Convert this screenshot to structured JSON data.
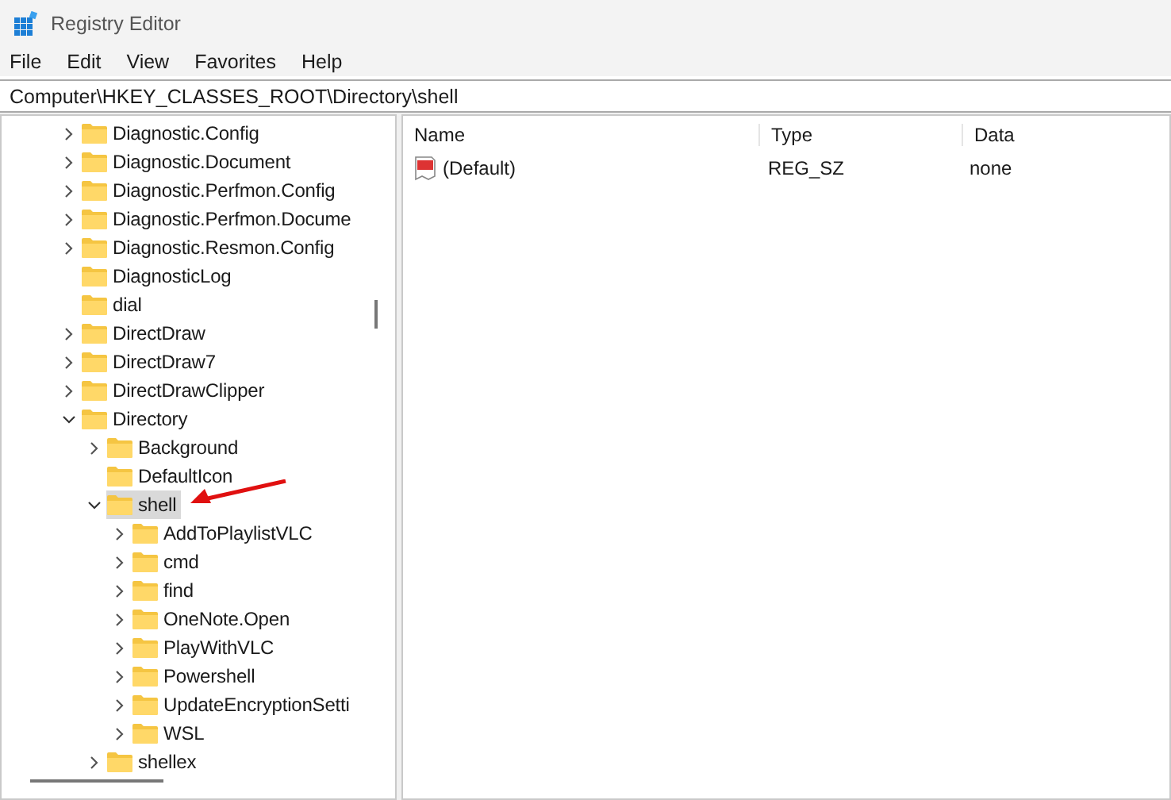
{
  "window": {
    "title": "Registry Editor"
  },
  "menu": [
    "File",
    "Edit",
    "View",
    "Favorites",
    "Help"
  ],
  "address": "Computer\\HKEY_CLASSES_ROOT\\Directory\\shell",
  "tree": [
    {
      "label": "Diagnostic.Config",
      "expandable": true,
      "expanded": false,
      "selected": false
    },
    {
      "label": "Diagnostic.Document",
      "expandable": true,
      "expanded": false,
      "selected": false
    },
    {
      "label": "Diagnostic.Perfmon.Config",
      "expandable": true,
      "expanded": false,
      "selected": false
    },
    {
      "label": "Diagnostic.Perfmon.Docume",
      "expandable": true,
      "expanded": false,
      "selected": false
    },
    {
      "label": "Diagnostic.Resmon.Config",
      "expandable": true,
      "expanded": false,
      "selected": false
    },
    {
      "label": "DiagnosticLog",
      "expandable": false,
      "expanded": false,
      "selected": false
    },
    {
      "label": "dial",
      "expandable": false,
      "expanded": false,
      "selected": false
    },
    {
      "label": "DirectDraw",
      "expandable": true,
      "expanded": false,
      "selected": false
    },
    {
      "label": "DirectDraw7",
      "expandable": true,
      "expanded": false,
      "selected": false
    },
    {
      "label": "DirectDrawClipper",
      "expandable": true,
      "expanded": false,
      "selected": false
    },
    {
      "label": "Directory",
      "expandable": true,
      "expanded": true,
      "selected": false,
      "children": [
        {
          "label": "Background",
          "expandable": true,
          "expanded": false,
          "selected": false
        },
        {
          "label": "DefaultIcon",
          "expandable": false,
          "expanded": false,
          "selected": false
        },
        {
          "label": "shell",
          "expandable": true,
          "expanded": true,
          "selected": true,
          "children": [
            {
              "label": "AddToPlaylistVLC",
              "expandable": true,
              "expanded": false,
              "selected": false
            },
            {
              "label": "cmd",
              "expandable": true,
              "expanded": false,
              "selected": false
            },
            {
              "label": "find",
              "expandable": true,
              "expanded": false,
              "selected": false
            },
            {
              "label": "OneNote.Open",
              "expandable": true,
              "expanded": false,
              "selected": false
            },
            {
              "label": "PlayWithVLC",
              "expandable": true,
              "expanded": false,
              "selected": false
            },
            {
              "label": "Powershell",
              "expandable": true,
              "expanded": false,
              "selected": false
            },
            {
              "label": "UpdateEncryptionSetti",
              "expandable": true,
              "expanded": false,
              "selected": false
            },
            {
              "label": "WSL",
              "expandable": true,
              "expanded": false,
              "selected": false
            }
          ]
        },
        {
          "label": "shellex",
          "expandable": true,
          "expanded": false,
          "selected": false
        }
      ]
    }
  ],
  "values": {
    "columns": [
      "Name",
      "Type",
      "Data"
    ],
    "rows": [
      {
        "name": "(Default)",
        "type": "REG_SZ",
        "data": "none"
      }
    ]
  }
}
